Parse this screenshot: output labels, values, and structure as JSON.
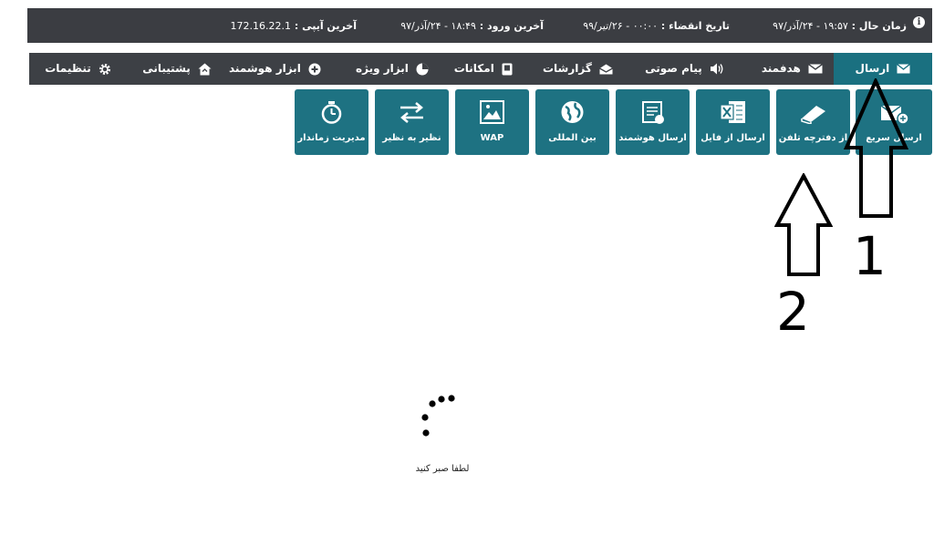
{
  "info": {
    "current_time_label": "زمان حال :",
    "current_time_value": "۱۹:۵۷ - ۲۴/آذر/۹۷",
    "expiry_label": "تاریخ انقضاء :",
    "expiry_value": "۰۰:۰۰ - ۲۶/تیر/۹۹",
    "last_login_label": "آخرین ورود :",
    "last_login_value": "۱۸:۴۹ - ۲۴/آذر/۹۷",
    "last_ip_label": "آخرین آیپی :",
    "last_ip_value": "172.16.22.1"
  },
  "nav": {
    "tabs": [
      {
        "label": "ارسال",
        "icon": "envelope-icon",
        "active": true
      },
      {
        "label": "هدفمند",
        "icon": "target-mail-icon"
      },
      {
        "label": "پیام صوتی",
        "icon": "speaker-icon"
      },
      {
        "label": "گزارشات",
        "icon": "open-envelope-icon"
      },
      {
        "label": "امکانات",
        "icon": "book-icon"
      },
      {
        "label": "ابزار ویژه",
        "icon": "pie-chart-icon"
      },
      {
        "label": "ابزار هوشمند",
        "icon": "plus-circle-icon"
      },
      {
        "label": "پشتیبانی",
        "icon": "home-icon"
      },
      {
        "label": "تنظیمات",
        "icon": "gear-icon"
      }
    ]
  },
  "tiles": [
    {
      "label": "ارسال سریع",
      "icon": "quick-send-icon"
    },
    {
      "label": "از دفترچه تلفن",
      "icon": "phonebook-icon"
    },
    {
      "label": "ارسال از فایل",
      "icon": "excel-file-icon"
    },
    {
      "label": "ارسال هوشمند",
      "icon": "smart-send-icon"
    },
    {
      "label": "بین المللی",
      "icon": "globe-icon"
    },
    {
      "label": "WAP",
      "icon": "wap-image-icon"
    },
    {
      "label": "نظیر به نظیر",
      "icon": "swap-arrows-icon"
    },
    {
      "label": "مدیریت زماندار",
      "icon": "stopwatch-icon"
    }
  ],
  "loading": {
    "text": "لطفا صبر کنید"
  },
  "annotations": {
    "arrow1_label": "1",
    "arrow2_label": "2"
  },
  "colors": {
    "teal": "#1e7282",
    "dark": "#3d4045"
  }
}
